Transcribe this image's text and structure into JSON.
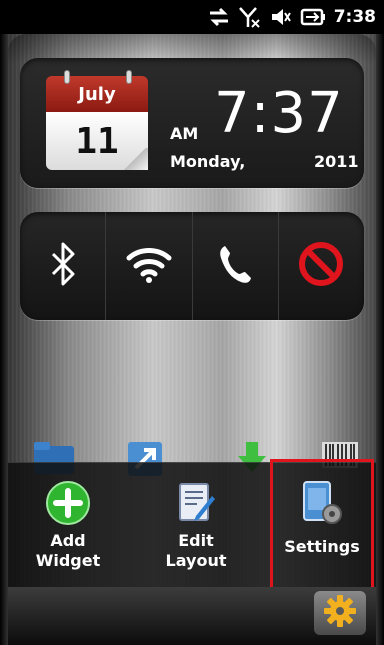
{
  "status_bar": {
    "icons": [
      "data-transfer-icon",
      "no-signal-icon",
      "volume-muted-icon",
      "battery-charging-icon"
    ],
    "time": "7:38"
  },
  "clock_widget": {
    "calendar_month": "July",
    "calendar_day": "11",
    "ampm": "AM",
    "time": "7:37",
    "weekday": "Monday,",
    "year": "2011"
  },
  "toggles": [
    {
      "name": "bluetooth",
      "icon": "bluetooth-icon"
    },
    {
      "name": "wifi",
      "icon": "wifi-icon"
    },
    {
      "name": "phone",
      "icon": "phone-icon"
    },
    {
      "name": "flight-mode",
      "icon": "no-entry-icon"
    }
  ],
  "menu": {
    "items": [
      {
        "label": "Add\nWidget",
        "icon": "add-icon"
      },
      {
        "label": "Edit\nLayout",
        "icon": "edit-layout-icon"
      },
      {
        "label": "Settings",
        "icon": "settings-icon"
      }
    ]
  },
  "colors": {
    "calendar_red": "#c0392b",
    "no_entry_red": "#e0141c",
    "add_green": "#2fb52f",
    "highlight_red": "#e0141c",
    "gear_gold": "#f2b01e"
  }
}
